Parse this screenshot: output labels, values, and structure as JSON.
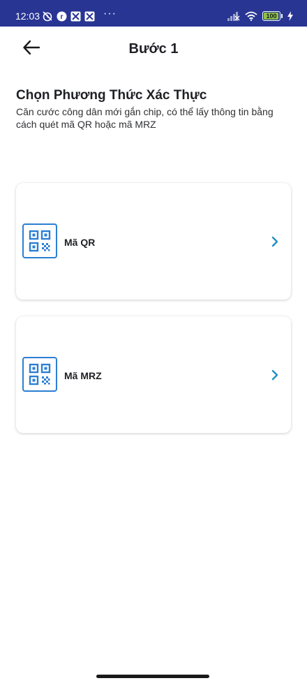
{
  "status_bar": {
    "time": "12:03",
    "overflow": "···",
    "battery_level": "100",
    "battery_fraction": 1.0,
    "left_icons": [
      "alarm-off-icon",
      "notification-r-icon",
      "app-icon-1",
      "app-icon-2"
    ],
    "right_icons": [
      "signal-icon",
      "wifi-icon",
      "battery-icon",
      "charging-icon"
    ],
    "background_color": "#283593"
  },
  "header": {
    "title": "Bước 1",
    "back_icon": "arrow-left-icon"
  },
  "intro": {
    "title": "Chọn Phương Thức Xác Thực",
    "description": "Căn cước công dân mới gắn chip, có thể lấy thông tin bằng cách quét mã QR hoặc mã MRZ"
  },
  "options": [
    {
      "label": "Mã QR",
      "icon": "qr-code-icon"
    },
    {
      "label": "Mã MRZ",
      "icon": "qr-code-icon"
    }
  ],
  "colors": {
    "accent": "#2b7fd4",
    "chevron": "#1f8fc4",
    "text_primary": "#1f2024"
  }
}
